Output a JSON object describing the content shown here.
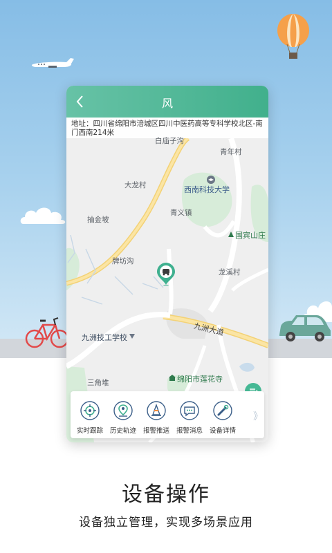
{
  "header": {
    "title": "风"
  },
  "address": {
    "text": "地址：四川省绵阳市涪城区四川中医药高等专科学校北区-南门西南214米"
  },
  "map": {
    "labels": [
      {
        "id": "baimiaozi",
        "text": "白庙子沟"
      },
      {
        "id": "qingnian",
        "text": "青年村"
      },
      {
        "id": "dalong",
        "text": "大龙村"
      },
      {
        "id": "xinan",
        "text": "西南科技大学"
      },
      {
        "id": "qingyi",
        "text": "青义镇"
      },
      {
        "id": "choujin",
        "text": "抽金坡"
      },
      {
        "id": "guobin",
        "text": "国宾山庄"
      },
      {
        "id": "paifang",
        "text": "牌坊沟"
      },
      {
        "id": "longxi",
        "text": "龙溪村"
      },
      {
        "id": "jiuzhou_road",
        "text": "九洲大道"
      },
      {
        "id": "jiuzhou_school",
        "text": "九洲技工学校"
      },
      {
        "id": "lianhua",
        "text": "绵阳市莲花寺"
      },
      {
        "id": "sanjiao",
        "text": "三角堆"
      }
    ],
    "marker_icon": "vehicle-location-pin-icon"
  },
  "toolbar": {
    "items": [
      {
        "label": "实时跟踪",
        "icon": "realtime-tracking-icon"
      },
      {
        "label": "历史轨迹",
        "icon": "history-track-icon"
      },
      {
        "label": "报警推送",
        "icon": "alarm-cone-icon"
      },
      {
        "label": "报警消息",
        "icon": "alarm-message-icon"
      },
      {
        "label": "设备详情",
        "icon": "device-detail-icon"
      }
    ],
    "more": "》"
  },
  "promo": {
    "headline": "设备操作",
    "subline": "设备独立管理，实现多场景应用"
  },
  "colors": {
    "accent": "#45b894",
    "header_start": "#67c2a6",
    "sky": "#86bde6",
    "ground": "#d2d6db"
  }
}
